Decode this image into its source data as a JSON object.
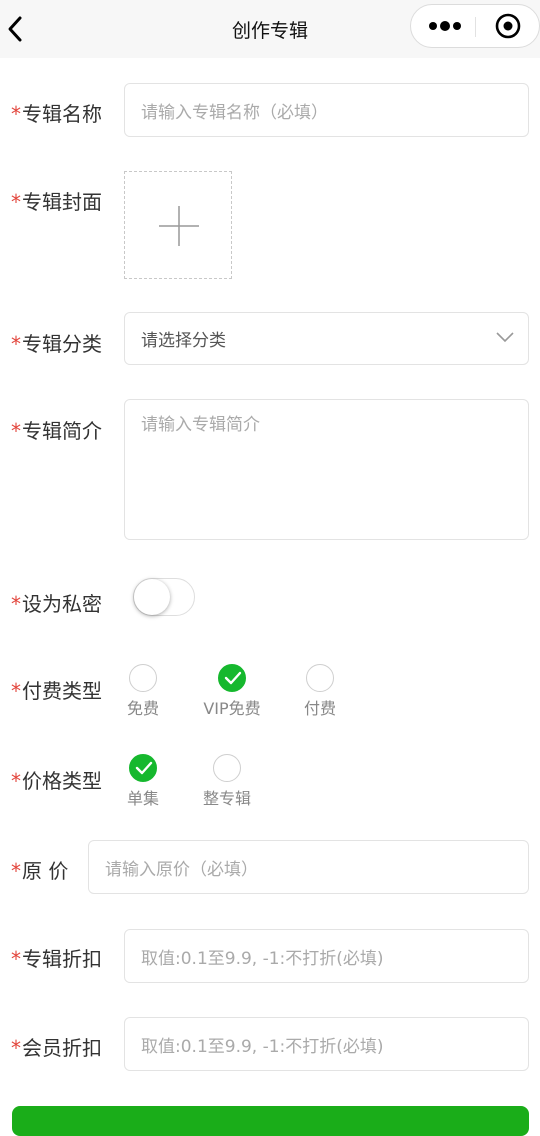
{
  "header": {
    "title": "创作专辑"
  },
  "form": {
    "required_mark": "*",
    "name": {
      "label": "专辑名称",
      "placeholder": "请输入专辑名称（必填）"
    },
    "cover": {
      "label": "专辑封面"
    },
    "category": {
      "label": "专辑分类",
      "value": "请选择分类"
    },
    "intro": {
      "label": "专辑简介",
      "placeholder": "请输入专辑简介"
    },
    "private": {
      "label": "设为私密",
      "on": false
    },
    "pay_type": {
      "label": "付费类型",
      "options": [
        "免费",
        "VIP免费",
        "付费"
      ],
      "selected": "VIP免费"
    },
    "price_type": {
      "label": "价格类型",
      "options": [
        "单集",
        "整专辑"
      ],
      "selected": "单集"
    },
    "original_price": {
      "label": "原 价",
      "placeholder": "请输入原价（必填）"
    },
    "album_discount": {
      "label": "专辑折扣",
      "placeholder": "取值:0.1至9.9, -1:不打折(必填)"
    },
    "member_discount": {
      "label": "会员折扣",
      "placeholder": "取值:0.1至9.9, -1:不打折(必填)"
    }
  },
  "colors": {
    "accent": "#1aad19",
    "required": "#e2453c"
  },
  "icons": [
    "back-arrow-icon",
    "more-icon",
    "target-icon",
    "plus-icon",
    "chevron-down-icon",
    "check-icon"
  ]
}
